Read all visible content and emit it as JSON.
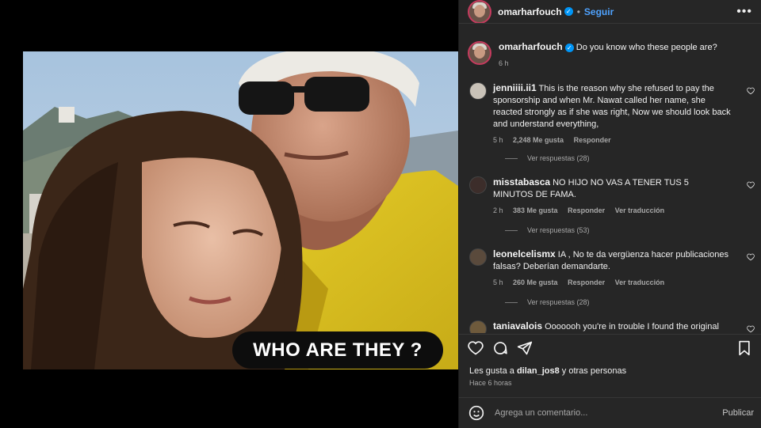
{
  "post": {
    "image_caption": "WHO ARE THEY ?"
  },
  "header": {
    "username": "omarharfouch",
    "verified_mark": "✓",
    "separator": "•",
    "follow_label": "Seguir",
    "more_icon": "more-horizontal-icon"
  },
  "caption": {
    "username": "omarharfouch",
    "text": "Do you know who these people are?",
    "time": "6 h"
  },
  "comments": [
    {
      "username": "jenniiii.ii1",
      "text": "This is the reason why she refused to pay the sponsorship and when Mr. Nawat called her name, she reacted strongly as if she was right, Now we should look back and understand everything,",
      "time": "5 h",
      "likes": "2,248 Me gusta",
      "reply": "Responder",
      "translate": "",
      "replies": "Ver respuestas (28)"
    },
    {
      "username": "misstabasca",
      "text": "NO HIJO NO VAS A TENER TUS 5 MINUTOS DE FAMA.",
      "time": "2 h",
      "likes": "383 Me gusta",
      "reply": "Responder",
      "translate": "Ver traducción",
      "replies": "Ver respuestas (53)"
    },
    {
      "username": "leonelcelismx",
      "text": "IA , No te da vergüenza hacer publicaciones falsas? Deberían demandarte.",
      "time": "5 h",
      "likes": "260 Me gusta",
      "reply": "Responder",
      "translate": "Ver traducción",
      "replies": "Ver respuestas (28)"
    },
    {
      "username": "taniavalois",
      "text": "Ooooooh you're in trouble I found the original",
      "time": "",
      "likes": "",
      "reply": "",
      "translate": "",
      "replies": ""
    }
  ],
  "actions": {
    "like_icon": "heart-icon",
    "comment_icon": "comment-icon",
    "share_icon": "paper-plane-icon",
    "save_icon": "bookmark-icon"
  },
  "likes_line": {
    "prefix": "Les gusta a ",
    "user": "dilan_jos8",
    "suffix": " y otras personas"
  },
  "post_time": "Hace 6 horas",
  "composer": {
    "emoji_icon": "emoji-icon",
    "placeholder": "Agrega un comentario...",
    "publish_label": "Publicar"
  },
  "colors": {
    "panel_bg": "#262626",
    "accent_link": "#4fa3ff",
    "verified_blue": "#0095f6",
    "muted_text": "#a8a8a8"
  }
}
